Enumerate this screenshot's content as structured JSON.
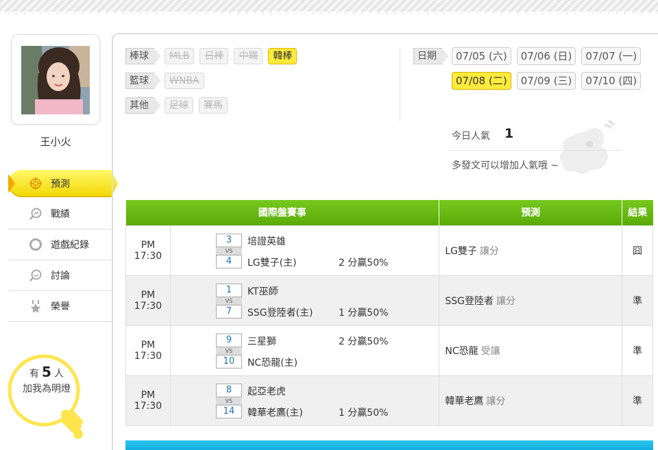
{
  "user": {
    "name": "王小火"
  },
  "nav": [
    {
      "label": "預測",
      "icon": "target-icon",
      "active": true
    },
    {
      "label": "戰績",
      "icon": "chart-search-icon"
    },
    {
      "label": "遊戲紀錄",
      "icon": "circle-icon"
    },
    {
      "label": "討論",
      "icon": "chat-search-icon"
    },
    {
      "label": "榮譽",
      "icon": "star-medal-icon"
    }
  ],
  "lamp": {
    "prefix": "有",
    "count": "5",
    "suffix": "人",
    "line2": "加我為明燈"
  },
  "categories": [
    {
      "label": "棒球",
      "items": [
        {
          "label": "MLB"
        },
        {
          "label": "日棒"
        },
        {
          "label": "中職"
        },
        {
          "label": "韓棒",
          "active": true
        }
      ]
    },
    {
      "label": "籃球",
      "items": [
        {
          "label": "WNBA"
        }
      ]
    },
    {
      "label": "其他",
      "items": [
        {
          "label": "足球"
        },
        {
          "label": "賽馬"
        }
      ]
    }
  ],
  "dates": {
    "label": "日期",
    "row1": [
      {
        "label": "07/05 (六)"
      },
      {
        "label": "07/06 (日)"
      },
      {
        "label": "07/07 (一)"
      }
    ],
    "row2": [
      {
        "label": "07/08 (二)",
        "active": true
      },
      {
        "label": "07/09 (三)"
      },
      {
        "label": "07/10 (四)"
      }
    ]
  },
  "popularity": {
    "label": "今日人氣",
    "value": "1",
    "message": "多發文可以增加人氣哦 ~"
  },
  "table": {
    "headers": {
      "match": "國際盤賽事",
      "prediction": "預測",
      "result": "結果"
    },
    "rows": [
      {
        "time": "PM 17:30",
        "score1": "3",
        "team1": "培證英雄",
        "vs": "VS",
        "score2": "4",
        "team2": "LG雙子(主)",
        "handicap": "2 分贏50%",
        "handicap_row": 2,
        "pred_team": "LG雙子",
        "pred_type": "讓分",
        "result": "囧"
      },
      {
        "time": "PM 17:30",
        "score1": "1",
        "team1": "KT巫師",
        "vs": "VS",
        "score2": "7",
        "team2": "SSG登陸者(主)",
        "handicap": "1 分贏50%",
        "handicap_row": 2,
        "pred_team": "SSG登陸者",
        "pred_type": "讓分",
        "result": "準"
      },
      {
        "time": "PM 17:30",
        "score1": "9",
        "team1": "三星獅",
        "vs": "VS",
        "score2": "10",
        "team2": "NC恐龍(主)",
        "handicap": "2 分贏50%",
        "handicap_row": 1,
        "pred_team": "NC恐龍",
        "pred_type": "受讓",
        "result": "準"
      },
      {
        "time": "PM 17:30",
        "score1": "8",
        "team1": "起亞老虎",
        "vs": "VS",
        "score2": "14",
        "team2": "韓華老鷹(主)",
        "handicap": "1 分贏50%",
        "handicap_row": 2,
        "pred_team": "韓華老鷹",
        "pred_type": "讓分",
        "result": "準"
      }
    ]
  },
  "colors": {
    "accent_yellow": "#ffeb3b",
    "header_green": "#5aab08",
    "header_blue": "#12aee0",
    "result_ok": "#2b8a20"
  }
}
